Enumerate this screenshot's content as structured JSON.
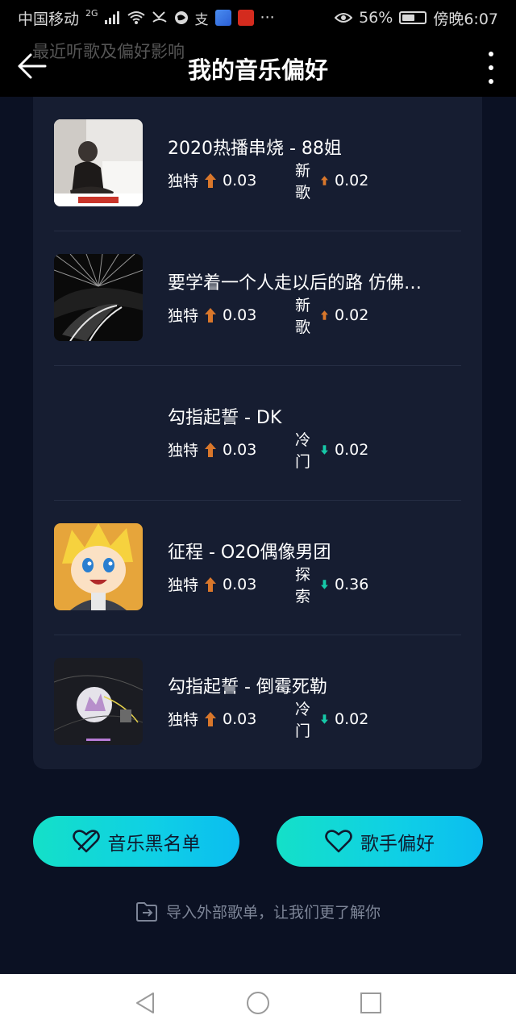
{
  "status_bar": {
    "carrier": "中国移动",
    "network": "2G",
    "more": "···",
    "battery": "56%",
    "battery_level": 0.56,
    "time": "傍晚6:07"
  },
  "header": {
    "ghost_text": "最近听歌及偏好影响",
    "title": "我的音乐偏好"
  },
  "songs": [
    {
      "title": "2020热播串烧 - 88姐",
      "tag1_label": "独特",
      "tag1_dir": "up",
      "tag1_value": "0.03",
      "tag2_label": "新歌",
      "tag2_dir": "up",
      "tag2_value": "0.02",
      "cover": "photo"
    },
    {
      "title": "要学着一个人走以后的路 仿佛…",
      "tag1_label": "独特",
      "tag1_dir": "up",
      "tag1_value": "0.03",
      "tag2_label": "新歌",
      "tag2_dir": "up",
      "tag2_value": "0.02",
      "cover": "road"
    },
    {
      "title": "勾指起誓 - DK",
      "tag1_label": "独特",
      "tag1_dir": "up",
      "tag1_value": "0.03",
      "tag2_label": "冷门",
      "tag2_dir": "down",
      "tag2_value": "0.02",
      "cover": "none"
    },
    {
      "title": "征程 - O2O偶像男团",
      "tag1_label": "独特",
      "tag1_dir": "up",
      "tag1_value": "0.03",
      "tag2_label": "探索",
      "tag2_dir": "down",
      "tag2_value": "0.36",
      "cover": "anime"
    },
    {
      "title": "勾指起誓 - 倒霉死勒",
      "tag1_label": "独特",
      "tag1_dir": "up",
      "tag1_value": "0.03",
      "tag2_label": "冷门",
      "tag2_dir": "down",
      "tag2_value": "0.02",
      "cover": "art"
    }
  ],
  "buttons": {
    "blacklist": "音乐黑名单",
    "singer_pref": "歌手偏好"
  },
  "import_link": "导入外部歌单，让我们更了解你",
  "colors": {
    "arrow_up": "#d9772b",
    "arrow_down": "#16c9a8",
    "accent": "#14e0c8"
  }
}
